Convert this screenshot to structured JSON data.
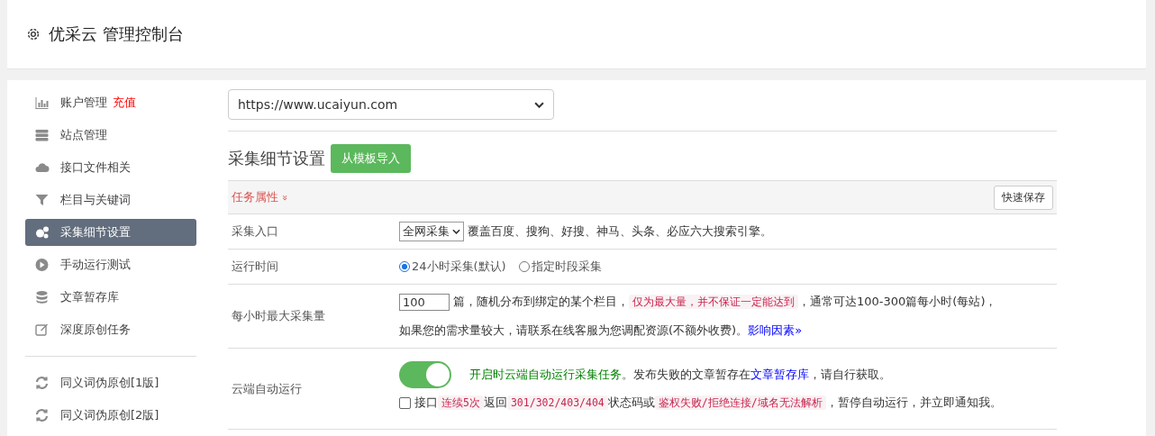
{
  "header": {
    "title": "优采云 管理控制台"
  },
  "sidebar": {
    "groups": [
      [
        {
          "label": "账户管理",
          "badge": "充值",
          "selected": false
        },
        {
          "label": "站点管理",
          "selected": false
        },
        {
          "label": "接口文件相关",
          "selected": false
        },
        {
          "label": "栏目与关键词",
          "selected": false
        },
        {
          "label": "采集细节设置",
          "selected": true
        },
        {
          "label": "手动运行测试",
          "selected": false
        },
        {
          "label": "文章暂存库",
          "selected": false
        },
        {
          "label": "深度原创任务",
          "selected": false
        }
      ],
      [
        {
          "label": "同义词伪原创[1版]",
          "selected": false
        },
        {
          "label": "同义词伪原创[2版]",
          "selected": false
        }
      ]
    ]
  },
  "site_select": {
    "value": "https://www.ucaiyun.com"
  },
  "section": {
    "title": "采集细节设置",
    "import_button": "从模板导入"
  },
  "panel": {
    "heading": "任务属性",
    "heading_caret": "»",
    "save_button": "快速保存",
    "rows": [
      {
        "kind": "select",
        "label": "采集入口",
        "select": "全网采集",
        "text": "覆盖百度、搜狗、好搜、神马、头条、必应六大搜索引擎。"
      },
      {
        "kind": "radio",
        "label": "运行时间",
        "options": [
          {
            "label": "24小时采集(默认)",
            "selected": true
          },
          {
            "label": "指定时段采集",
            "selected": false
          }
        ]
      },
      {
        "kind": "amount",
        "label": "每小时最大采集量",
        "value": "100",
        "text1": "篇，随机分布到绑定的某个栏目，",
        "code": "仅为最大量，并不保证一定能达到",
        "text2": "，通常可达100-300篇每小时(每站)，",
        "text3": "如果您的需求量较大，请联系在线客服为您调配资源(不额外收费)。",
        "link": "影响因素",
        "link_caret": "»"
      },
      {
        "kind": "toggle",
        "label": "云端自动运行",
        "on": true,
        "green_text": "开启时云端自动运行采集任务",
        "text1": "。发布失败的文章暂存在",
        "link": "文章暂存库",
        "text2": "，请自行获取。",
        "check": {
          "checked": false,
          "parts": [
            {
              "kind": "text",
              "t": "接口"
            },
            {
              "kind": "code",
              "t": "连续5次"
            },
            {
              "kind": "text",
              "t": "返回"
            },
            {
              "kind": "code",
              "t": "301/302/403/404"
            },
            {
              "kind": "text",
              "t": "状态码或"
            },
            {
              "kind": "code",
              "t": "鉴权失败/拒绝连接/域名无法解析"
            },
            {
              "kind": "text",
              "t": "，暂停自动运行，并立即通知我。"
            }
          ]
        }
      }
    ]
  }
}
